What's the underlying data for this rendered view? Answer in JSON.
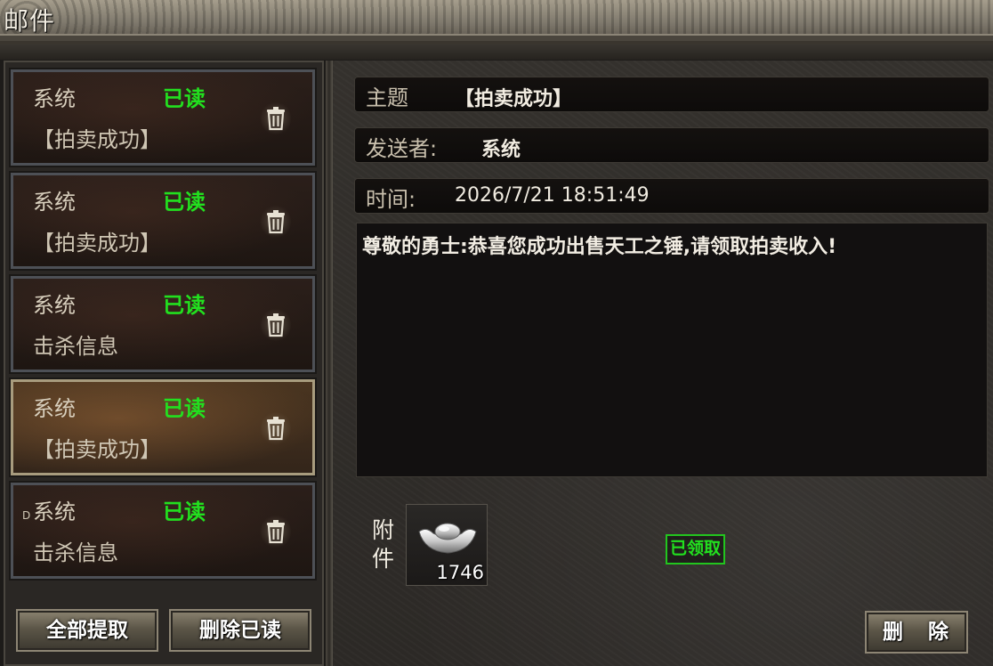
{
  "window": {
    "title": "邮件"
  },
  "mail_list": [
    {
      "sender": "系统",
      "status": "已读",
      "subject": "【拍卖成功】"
    },
    {
      "sender": "系统",
      "status": "已读",
      "subject": "【拍卖成功】"
    },
    {
      "sender": "系统",
      "status": "已读",
      "subject": "击杀信息"
    },
    {
      "sender": "系统",
      "status": "已读",
      "subject": "【拍卖成功】",
      "selected": true
    },
    {
      "sender": "系统",
      "status": "已读",
      "subject": "击杀信息"
    }
  ],
  "marker": "D",
  "left_buttons": {
    "claim_all": "全部提取",
    "delete_read": "删除已读"
  },
  "detail": {
    "subject_label": "主题",
    "subject_value": "【拍卖成功】",
    "sender_label": "发送者:",
    "sender_value": "系统",
    "time_label": "时间:",
    "time_value": "2026/7/21 18:51:49",
    "body": "尊敬的勇士:恭喜您成功出售天工之锤,请领取拍卖收入!",
    "attachment_label_1": "附",
    "attachment_label_2": "件",
    "attachment": {
      "icon": "silver-ingot-icon",
      "count": "1746"
    },
    "claimed_badge": "已领取",
    "delete_button": "删 除"
  },
  "colors": {
    "read_status": "#22e01f",
    "accent_border": "#a89c7e"
  }
}
